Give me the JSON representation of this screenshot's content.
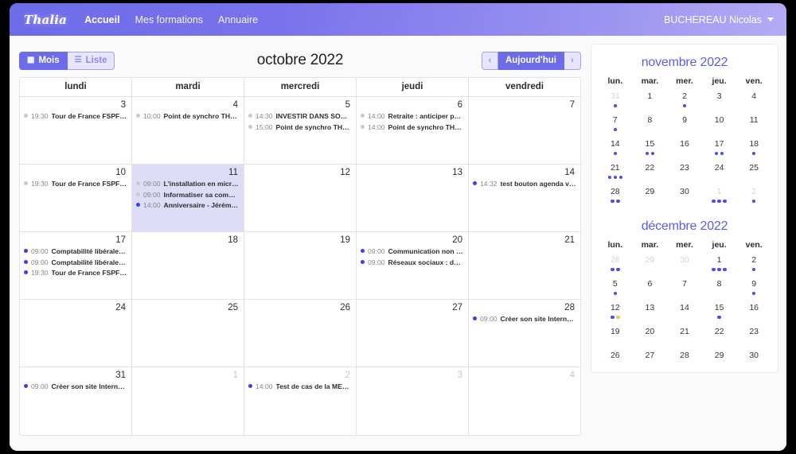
{
  "navbar": {
    "logo": "Thalia",
    "links": [
      {
        "label": "Accueil",
        "active": true
      },
      {
        "label": "Mes formations",
        "active": false
      },
      {
        "label": "Annuaire",
        "active": false
      }
    ],
    "user": "BUCHEREAU Nicolas",
    "caret_icon": "chevron-down-icon"
  },
  "toolbar": {
    "view_mois": "Mois",
    "view_mois_icon": "calendar-icon",
    "view_liste": "Liste",
    "view_liste_icon": "list-icon",
    "month_title": "octobre 2022",
    "prev_label": "‹",
    "prev_icon": "chevron-left-icon",
    "today_label": "Aujourd'hui",
    "next_label": "›",
    "next_icon": "chevron-right-icon"
  },
  "calendar": {
    "weekdays": [
      "lundi",
      "mardi",
      "mercredi",
      "jeudi",
      "vendredi"
    ],
    "weeks": [
      [
        {
          "num": "3",
          "other": false,
          "today": false,
          "events": [
            {
              "dot": "gray",
              "time": "19:30",
              "title": "Tour de France FSPF - La ..."
            }
          ]
        },
        {
          "num": "4",
          "other": false,
          "today": false,
          "events": [
            {
              "dot": "gray",
              "time": "10:00",
              "title": "Point de synchro THALIA ..."
            }
          ]
        },
        {
          "num": "5",
          "other": false,
          "today": false,
          "events": [
            {
              "dot": "gray",
              "time": "14:30",
              "title": "INVESTIR DANS SON LOC..."
            },
            {
              "dot": "gray",
              "time": "15:00",
              "title": "Point de synchro THALIA ..."
            }
          ]
        },
        {
          "num": "6",
          "other": false,
          "today": false,
          "events": [
            {
              "dot": "gray",
              "time": "14:00",
              "title": "Retraite : anticiper pour n..."
            },
            {
              "dot": "gray",
              "time": "14:00",
              "title": "Point de synchro THALIA ..."
            }
          ]
        },
        {
          "num": "7",
          "other": false,
          "today": false,
          "events": []
        }
      ],
      [
        {
          "num": "10",
          "other": false,
          "today": false,
          "events": [
            {
              "dot": "gray",
              "time": "19:30",
              "title": "Tour de France FSPF - Vac..."
            }
          ]
        },
        {
          "num": "11",
          "other": false,
          "today": true,
          "events": [
            {
              "dot": "gray",
              "time": "09:00",
              "title": "L'installation en micro e..."
            },
            {
              "dot": "gray",
              "time": "09:00",
              "title": "Informatiser sa comptab..."
            },
            {
              "dot": "blue",
              "time": "14:00",
              "title": "Anniversaire - Jérémy ES..."
            }
          ]
        },
        {
          "num": "12",
          "other": false,
          "today": false,
          "events": []
        },
        {
          "num": "13",
          "other": false,
          "today": false,
          "events": []
        },
        {
          "num": "14",
          "other": false,
          "today": false,
          "events": [
            {
              "dot": "blue",
              "time": "14:32",
              "title": "test bouton agenda via g..."
            }
          ]
        }
      ],
      [
        {
          "num": "17",
          "other": false,
          "today": false,
          "events": [
            {
              "dot": "blue",
              "time": "09:00",
              "title": "Comptabilité libérale : Ba..."
            },
            {
              "dot": "blue",
              "time": "09:00",
              "title": "Comptabilité libérale : Ba..."
            },
            {
              "dot": "blue",
              "time": "19:30",
              "title": "Tour de France FSPF - Dé..."
            }
          ]
        },
        {
          "num": "18",
          "other": false,
          "today": false,
          "events": []
        },
        {
          "num": "19",
          "other": false,
          "today": false,
          "events": []
        },
        {
          "num": "20",
          "other": false,
          "today": false,
          "events": [
            {
              "dot": "blue",
              "time": "09:00",
              "title": "Communication non viol..."
            },
            {
              "dot": "blue",
              "time": "09:00",
              "title": "Réseaux sociaux : dévelo..."
            }
          ]
        },
        {
          "num": "21",
          "other": false,
          "today": false,
          "events": []
        }
      ],
      [
        {
          "num": "24",
          "other": false,
          "today": false,
          "events": []
        },
        {
          "num": "25",
          "other": false,
          "today": false,
          "events": []
        },
        {
          "num": "26",
          "other": false,
          "today": false,
          "events": []
        },
        {
          "num": "27",
          "other": false,
          "today": false,
          "events": []
        },
        {
          "num": "28",
          "other": false,
          "today": false,
          "events": [
            {
              "dot": "blue",
              "time": "09:00",
              "title": "Créer son site Internet av..."
            }
          ]
        }
      ],
      [
        {
          "num": "31",
          "other": false,
          "today": false,
          "events": [
            {
              "dot": "blue",
              "time": "09:00",
              "title": "Créer son site Internet av..."
            }
          ]
        },
        {
          "num": "1",
          "other": true,
          "today": false,
          "events": []
        },
        {
          "num": "2",
          "other": true,
          "today": false,
          "events": [
            {
              "dot": "blue",
              "time": "14:00",
              "title": "Test de cas de la MEP du ..."
            }
          ]
        },
        {
          "num": "3",
          "other": true,
          "today": false,
          "events": []
        },
        {
          "num": "4",
          "other": true,
          "today": false,
          "events": []
        }
      ]
    ]
  },
  "mini_calendars": [
    {
      "title": "novembre 2022",
      "weekdays": [
        "lun.",
        "mar.",
        "mer.",
        "jeu.",
        "ven."
      ],
      "weeks": [
        [
          {
            "num": "31",
            "other": true,
            "dots": [
              "blue"
            ]
          },
          {
            "num": "1",
            "other": false,
            "dots": []
          },
          {
            "num": "2",
            "other": false,
            "dots": [
              "blue"
            ]
          },
          {
            "num": "3",
            "other": false,
            "dots": []
          },
          {
            "num": "4",
            "other": false,
            "dots": []
          }
        ],
        [
          {
            "num": "7",
            "other": false,
            "dots": [
              "blue"
            ]
          },
          {
            "num": "8",
            "other": false,
            "dots": []
          },
          {
            "num": "9",
            "other": false,
            "dots": []
          },
          {
            "num": "10",
            "other": false,
            "dots": []
          },
          {
            "num": "11",
            "other": false,
            "dots": []
          }
        ],
        [
          {
            "num": "14",
            "other": false,
            "dots": [
              "blue"
            ]
          },
          {
            "num": "15",
            "other": false,
            "dots": [
              "blue",
              "blue"
            ]
          },
          {
            "num": "16",
            "other": false,
            "dots": []
          },
          {
            "num": "17",
            "other": false,
            "dots": [
              "blue",
              "blue"
            ]
          },
          {
            "num": "18",
            "other": false,
            "dots": [
              "blue"
            ]
          }
        ],
        [
          {
            "num": "21",
            "other": false,
            "dots": [
              "blue",
              "blue",
              "blue"
            ]
          },
          {
            "num": "22",
            "other": false,
            "dots": []
          },
          {
            "num": "23",
            "other": false,
            "dots": []
          },
          {
            "num": "24",
            "other": false,
            "dots": []
          },
          {
            "num": "25",
            "other": false,
            "dots": []
          }
        ],
        [
          {
            "num": "28",
            "other": false,
            "dots": [
              "blue",
              "blue"
            ]
          },
          {
            "num": "29",
            "other": false,
            "dots": []
          },
          {
            "num": "30",
            "other": false,
            "dots": []
          },
          {
            "num": "1",
            "other": true,
            "dots": [
              "blue",
              "blue",
              "blue"
            ]
          },
          {
            "num": "2",
            "other": true,
            "dots": [
              "blue"
            ]
          }
        ]
      ]
    },
    {
      "title": "décembre 2022",
      "weekdays": [
        "lun.",
        "mar.",
        "mer.",
        "jeu.",
        "ven."
      ],
      "weeks": [
        [
          {
            "num": "28",
            "other": true,
            "dots": [
              "blue",
              "blue"
            ]
          },
          {
            "num": "29",
            "other": true,
            "dots": []
          },
          {
            "num": "30",
            "other": true,
            "dots": []
          },
          {
            "num": "1",
            "other": false,
            "dots": [
              "blue",
              "blue",
              "blue"
            ]
          },
          {
            "num": "2",
            "other": false,
            "dots": [
              "blue"
            ]
          }
        ],
        [
          {
            "num": "5",
            "other": false,
            "dots": [
              "blue"
            ]
          },
          {
            "num": "6",
            "other": false,
            "dots": []
          },
          {
            "num": "7",
            "other": false,
            "dots": []
          },
          {
            "num": "8",
            "other": false,
            "dots": []
          },
          {
            "num": "9",
            "other": false,
            "dots": [
              "blue"
            ]
          }
        ],
        [
          {
            "num": "12",
            "other": false,
            "dots": [
              "blue",
              "orange"
            ]
          },
          {
            "num": "13",
            "other": false,
            "dots": []
          },
          {
            "num": "14",
            "other": false,
            "dots": []
          },
          {
            "num": "15",
            "other": false,
            "dots": [
              "blue"
            ]
          },
          {
            "num": "16",
            "other": false,
            "dots": []
          }
        ],
        [
          {
            "num": "19",
            "other": false,
            "dots": []
          },
          {
            "num": "20",
            "other": false,
            "dots": []
          },
          {
            "num": "21",
            "other": false,
            "dots": []
          },
          {
            "num": "22",
            "other": false,
            "dots": []
          },
          {
            "num": "23",
            "other": false,
            "dots": []
          }
        ],
        [
          {
            "num": "26",
            "other": false,
            "dots": []
          },
          {
            "num": "27",
            "other": false,
            "dots": []
          },
          {
            "num": "28",
            "other": false,
            "dots": []
          },
          {
            "num": "29",
            "other": false,
            "dots": []
          },
          {
            "num": "30",
            "other": false,
            "dots": []
          }
        ]
      ]
    }
  ],
  "colors": {
    "brand": "#6c6ce8",
    "accent": "#5c5cf0",
    "event_blue": "#3d3df0",
    "event_gray": "#c9cace",
    "event_orange": "#f5c264",
    "today_bg": "#dedcf6"
  }
}
